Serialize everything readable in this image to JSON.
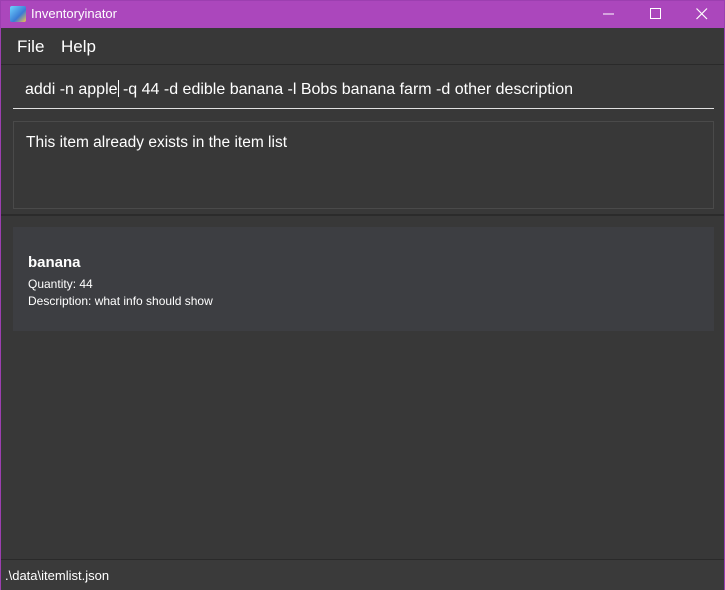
{
  "window": {
    "title": "Inventoryinator",
    "icon": "app-icon"
  },
  "menu": {
    "file_label": "File",
    "help_label": "Help"
  },
  "command": {
    "before_caret": "addi -n apple",
    "after_caret": " -q 44 -d edible banana -l Bobs banana farm -d other description"
  },
  "result": {
    "message": "This item already exists in the item list"
  },
  "items": [
    {
      "name": "banana",
      "quantity": "Quantity: 44",
      "description": "Description: what info should show"
    }
  ],
  "status": {
    "file_path": ".\\data\\itemlist.json"
  },
  "colors": {
    "titlebar": "#ab47bc",
    "background": "#383838",
    "card": "#3d3e42"
  }
}
